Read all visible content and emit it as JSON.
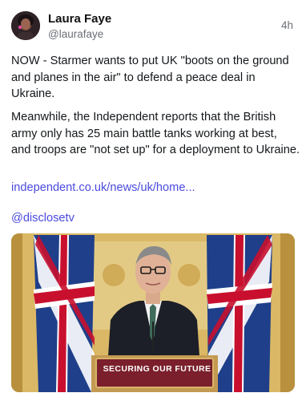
{
  "author": {
    "name": "Laura Faye",
    "handle": "@laurafaye",
    "time": "4h"
  },
  "post": {
    "paragraph1": "NOW - Starmer wants to put UK \"boots on the ground and planes in the air\" to defend a peace deal in Ukraine.",
    "paragraph2": "Meanwhile, the Independent reports that the British army only has 25 main battle tanks working at best, and troops are \"not set up\" for a deployment to Ukraine.",
    "link_text": "independent.co.uk/news/uk/home...",
    "mention": "@disclosetv"
  },
  "media": {
    "podium_sign": "SECURING OUR FUTURE"
  },
  "colors": {
    "link": "#4a4adf",
    "muted": "#6b6f76",
    "podium": "#7a1f2b"
  }
}
